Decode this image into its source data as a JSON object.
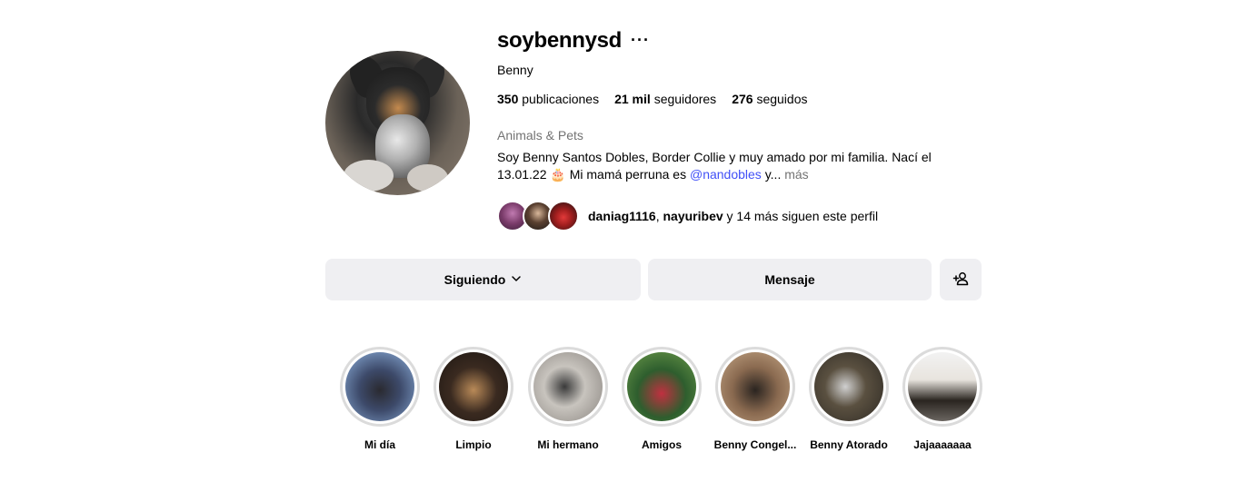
{
  "profile": {
    "username": "soybennysd",
    "more_glyph": "···",
    "display_name": "Benny",
    "stats": {
      "posts_count": "350",
      "posts_label": "publicaciones",
      "followers_count": "21 mil",
      "followers_label": "seguidores",
      "following_count": "276",
      "following_label": "seguidos"
    },
    "category": "Animals & Pets",
    "bio_text": "Soy Benny Santos Dobles, Border Collie y muy amado por mi familia. Nací el 13.01.22 🎂 Mi mamá perruna es ",
    "bio_mention": "@nandobles",
    "bio_suffix": " y...",
    "bio_more": "más",
    "followed_by": {
      "user1": "daniag1116",
      "separator": ",",
      "user2": "nayuribev",
      "rest": " y 14 más siguen este perfil"
    }
  },
  "actions": {
    "following_label": "Siguiendo",
    "message_label": "Mensaje",
    "add_user_icon": "add-user-icon"
  },
  "highlights": [
    {
      "label": "Mi día"
    },
    {
      "label": "Limpio"
    },
    {
      "label": "Mi hermano"
    },
    {
      "label": "Amigos"
    },
    {
      "label": "Benny Congel..."
    },
    {
      "label": "Benny Atorado"
    },
    {
      "label": "Jajaaaaaaa"
    }
  ],
  "colors": {
    "mention": "#4150f7",
    "muted": "#737373",
    "button_bg": "#efeff2",
    "ring": "#dbdbdb"
  }
}
